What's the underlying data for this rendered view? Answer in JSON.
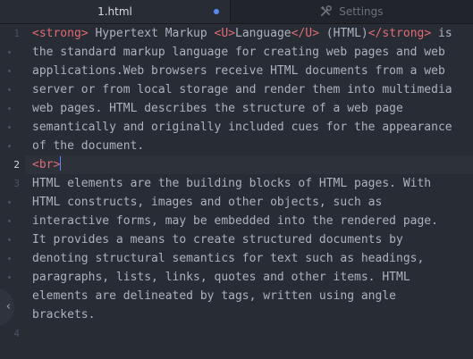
{
  "tabs": [
    {
      "label": "1.html",
      "modified": true,
      "active": true
    },
    {
      "label": "Settings",
      "icon": "tools-icon",
      "active": false
    }
  ],
  "colors": {
    "background": "#282c34",
    "tabbar": "#21252b",
    "tag": "#e06c75",
    "text": "#abb2bf",
    "accent": "#568af2"
  },
  "editor": {
    "line_numbers": [
      "1",
      "2",
      "3",
      "4"
    ],
    "cursor_line": "2",
    "lines": [
      {
        "number": "1",
        "rows": [
          [
            {
              "k": "tag",
              "t": "<strong>"
            },
            {
              "k": "txt",
              "t": " Hypertext Markup "
            },
            {
              "k": "tag",
              "t": "<U>"
            },
            {
              "k": "txt",
              "t": "Language"
            },
            {
              "k": "tag",
              "t": "</U>"
            },
            {
              "k": "txt",
              "t": " (HTML)"
            },
            {
              "k": "tag",
              "t": "</strong>"
            },
            {
              "k": "txt",
              "t": " is"
            }
          ],
          [
            {
              "k": "txt",
              "t": "the standard markup language for creating web pages and web"
            }
          ],
          [
            {
              "k": "txt",
              "t": "applications.Web browsers receive HTML documents from a web"
            }
          ],
          [
            {
              "k": "txt",
              "t": "server or from local storage and render them into multimedia"
            }
          ],
          [
            {
              "k": "txt",
              "t": "web pages. HTML describes the structure of a web page"
            }
          ],
          [
            {
              "k": "txt",
              "t": "semantically and originally included cues for the appearance"
            }
          ],
          [
            {
              "k": "txt",
              "t": "of the document."
            }
          ]
        ]
      },
      {
        "number": "2",
        "rows": [
          [
            {
              "k": "tag",
              "t": "<br>"
            }
          ]
        ]
      },
      {
        "number": "3",
        "rows": [
          [
            {
              "k": "txt",
              "t": "HTML elements are the building blocks of HTML pages. With"
            }
          ],
          [
            {
              "k": "txt",
              "t": "HTML constructs, images and other objects, such as"
            }
          ],
          [
            {
              "k": "txt",
              "t": "interactive forms, may be embedded into the rendered page."
            }
          ],
          [
            {
              "k": "txt",
              "t": "It provides a means to create structured documents by"
            }
          ],
          [
            {
              "k": "txt",
              "t": "denoting structural semantics for text such as headings,"
            }
          ],
          [
            {
              "k": "txt",
              "t": "paragraphs, lists, links, quotes and other items. HTML"
            }
          ],
          [
            {
              "k": "txt",
              "t": "elements are delineated by tags, written using angle"
            }
          ],
          [
            {
              "k": "txt",
              "t": "brackets."
            }
          ]
        ]
      },
      {
        "number": "4",
        "rows": [
          [
            {
              "k": "txt",
              "t": ""
            }
          ]
        ]
      }
    ]
  },
  "side_handle": {
    "glyph": "‹",
    "icon": "chevron-left-icon"
  }
}
